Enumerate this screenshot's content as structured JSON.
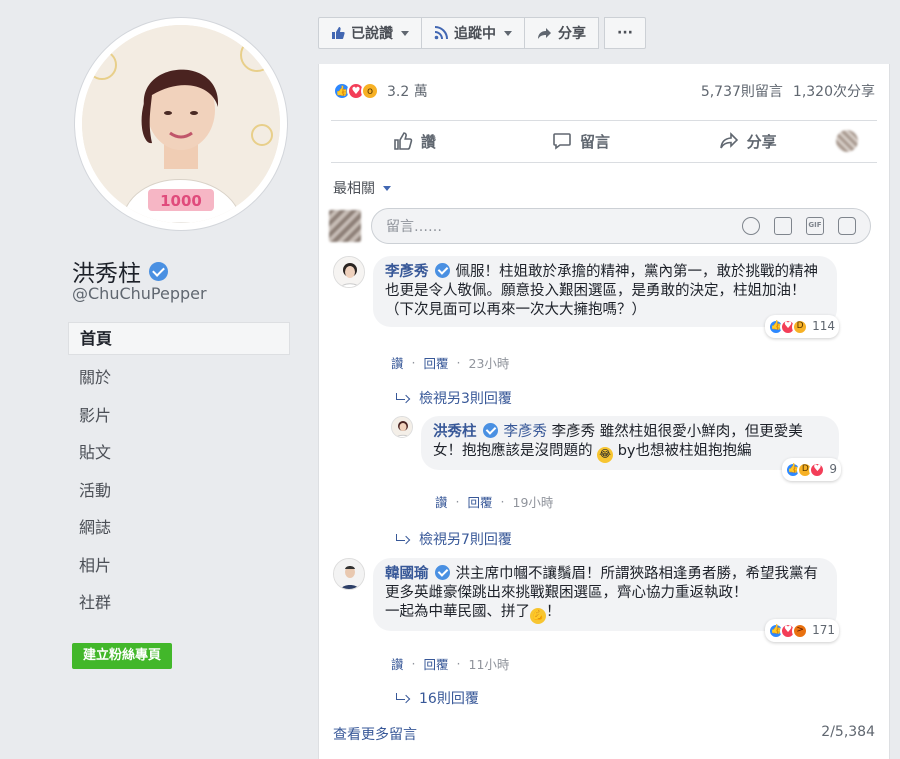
{
  "profile": {
    "name": "洪秀柱",
    "handle": "@ChuChuPepper",
    "cake_text": "1000"
  },
  "nav": {
    "items": [
      {
        "label": "首頁",
        "active": true
      },
      {
        "label": "關於"
      },
      {
        "label": "影片"
      },
      {
        "label": "貼文"
      },
      {
        "label": "活動"
      },
      {
        "label": "網誌"
      },
      {
        "label": "相片"
      },
      {
        "label": "社群"
      }
    ],
    "create_page_label": "建立粉絲專頁"
  },
  "topbar": {
    "liked_label": "已說讚",
    "following_label": "追蹤中",
    "share_label": "分享",
    "more_label": "···"
  },
  "post": {
    "reaction_count": "3.2 萬",
    "comments_count": "5,737則留言",
    "shares_count": "1,320次分享",
    "actions": {
      "like": "讚",
      "comment": "留言",
      "share": "分享"
    },
    "sort_label": "最相關",
    "composer_placeholder": "留言……"
  },
  "comments": {
    "c1": {
      "author": "李彥秀",
      "text": "佩服！柱姐敢於承擔的精神，黨內第一，敢於挑戰的精神也更是令人敬佩。願意投入艱困選區，是勇敢的決定，柱姐加油！（下次見面可以再來一次大大擁抱嗎？）",
      "reaction_count": "114",
      "like_label": "讚",
      "reply_label": "回覆",
      "time": "23小時",
      "replies_link": "檢視另3則回覆"
    },
    "r1": {
      "author": "洪秀柱",
      "mention": "李彥秀",
      "text": " 李彥秀 雖然柱姐很愛小鮮肉，但更愛美女！抱抱應該是沒問題的",
      "text_end": " by也想被柱姐抱抱編",
      "reaction_count": "9",
      "like_label": "讚",
      "reply_label": "回覆",
      "time": "19小時",
      "replies_link": "檢視另7則回覆"
    },
    "c2": {
      "author": "韓國瑜",
      "text": "洪主席巾幗不讓鬚眉！所謂狹路相逢勇者勝，希望我黨有更多英雌豪傑跳出來挑戰艱困選區，齊心協力重返執政！",
      "text2": "一起為中華民國、拼了",
      "text2_end": "！",
      "reaction_count": "171",
      "like_label": "讚",
      "reply_label": "回覆",
      "time": "11小時",
      "replies_link": "16則回覆"
    }
  },
  "footer": {
    "more_comments": "查看更多留言",
    "page_count": "2/5,384"
  },
  "colors": {
    "link": "#385898",
    "facebook_blue": "#4267b2",
    "create_button": "#42b72a",
    "background": "#e9ebee"
  }
}
